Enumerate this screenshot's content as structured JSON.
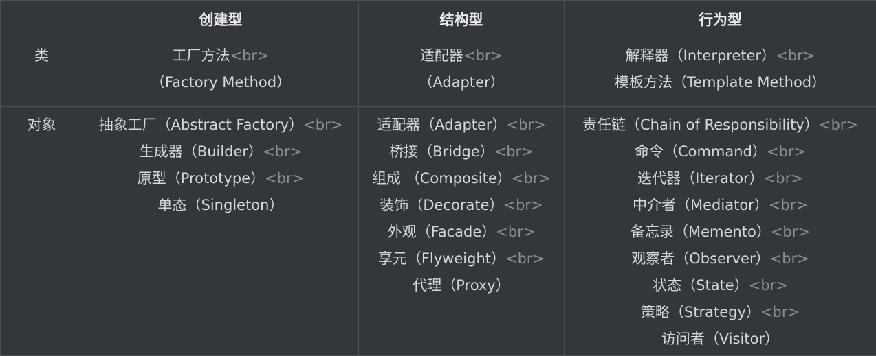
{
  "headers": [
    "",
    "创建型",
    "结构型",
    "行为型"
  ],
  "rows": [
    {
      "label": "类",
      "cells": [
        [
          {
            "text": "工厂方法",
            "br": true
          },
          {
            "text": "（Factory Method）",
            "br": false
          }
        ],
        [
          {
            "text": "适配器",
            "br": true
          },
          {
            "text": "（Adapter）",
            "br": false
          }
        ],
        [
          {
            "text": "解释器（Interpreter）",
            "br": true
          },
          {
            "text": "模板方法（Template Method）",
            "br": false
          }
        ]
      ]
    },
    {
      "label": "对象",
      "cells": [
        [
          {
            "text": "抽象工厂（Abstract Factory）",
            "br": true
          },
          {
            "text": "生成器（Builder）",
            "br": true
          },
          {
            "text": "原型（Prototype）",
            "br": true
          },
          {
            "text": "单态（Singleton）",
            "br": false
          }
        ],
        [
          {
            "text": "适配器（Adapter）",
            "br": true
          },
          {
            "text": "桥接（Bridge）",
            "br": true
          },
          {
            "text": "组成 （Composite）",
            "br": true
          },
          {
            "text": "装饰（Decorate）",
            "br": true
          },
          {
            "text": "外观（Facade）",
            "br": true
          },
          {
            "text": "享元（Flyweight）",
            "br": true
          },
          {
            "text": "代理（Proxy）",
            "br": false
          }
        ],
        [
          {
            "text": "责任链（Chain of Responsibility）",
            "br": true
          },
          {
            "text": "命令（Command）",
            "br": true
          },
          {
            "text": "迭代器（Iterator）",
            "br": true
          },
          {
            "text": "中介者（Mediator）",
            "br": true
          },
          {
            "text": "备忘录（Memento）",
            "br": true
          },
          {
            "text": "观察者（Observer）",
            "br": true
          },
          {
            "text": "状态（State）",
            "br": true
          },
          {
            "text": "策略（Strategy）",
            "br": true
          },
          {
            "text": "访问者（Visitor）",
            "br": false
          }
        ]
      ]
    }
  ],
  "br_tag": "<br>"
}
